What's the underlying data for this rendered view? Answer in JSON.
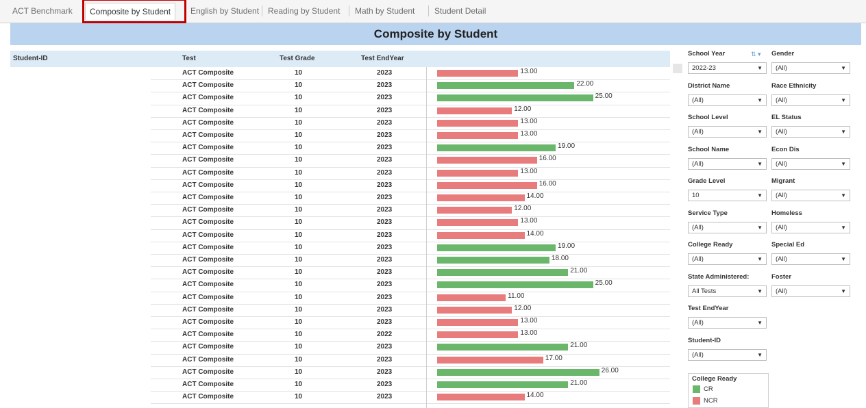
{
  "tabs": [
    "ACT Benchmark",
    "Composite by Student",
    "English by Student",
    "Reading by Student",
    "Math by Student",
    "Student Detail"
  ],
  "active_tab": "Composite by Student",
  "title": "Composite by Student",
  "columns": {
    "student_id": "Student-ID",
    "test": "Test",
    "test_grade": "Test Grade",
    "test_endyear": "Test EndYear"
  },
  "colors": {
    "cr": "#6ab76b",
    "ncr": "#e87b7b",
    "banner": "#bad4f0",
    "header": "#ddebf7"
  },
  "chart_data": {
    "type": "bar",
    "title": "Composite by Student",
    "orientation": "horizontal",
    "x_max": 28,
    "rows": [
      {
        "test": "ACT Composite",
        "grade": "10",
        "year": "2023",
        "value": 13,
        "label": "13.00",
        "status": "NCR"
      },
      {
        "test": "ACT Composite",
        "grade": "10",
        "year": "2023",
        "value": 22,
        "label": "22.00",
        "status": "CR"
      },
      {
        "test": "ACT Composite",
        "grade": "10",
        "year": "2023",
        "value": 25,
        "label": "25.00",
        "status": "CR"
      },
      {
        "test": "ACT Composite",
        "grade": "10",
        "year": "2023",
        "value": 12,
        "label": "12.00",
        "status": "NCR"
      },
      {
        "test": "ACT Composite",
        "grade": "10",
        "year": "2023",
        "value": 13,
        "label": "13.00",
        "status": "NCR"
      },
      {
        "test": "ACT Composite",
        "grade": "10",
        "year": "2023",
        "value": 13,
        "label": "13.00",
        "status": "NCR"
      },
      {
        "test": "ACT Composite",
        "grade": "10",
        "year": "2023",
        "value": 19,
        "label": "19.00",
        "status": "CR"
      },
      {
        "test": "ACT Composite",
        "grade": "10",
        "year": "2023",
        "value": 16,
        "label": "16.00",
        "status": "NCR"
      },
      {
        "test": "ACT Composite",
        "grade": "10",
        "year": "2023",
        "value": 13,
        "label": "13.00",
        "status": "NCR"
      },
      {
        "test": "ACT Composite",
        "grade": "10",
        "year": "2023",
        "value": 16,
        "label": "16.00",
        "status": "NCR"
      },
      {
        "test": "ACT Composite",
        "grade": "10",
        "year": "2023",
        "value": 14,
        "label": "14.00",
        "status": "NCR"
      },
      {
        "test": "ACT Composite",
        "grade": "10",
        "year": "2023",
        "value": 12,
        "label": "12.00",
        "status": "NCR"
      },
      {
        "test": "ACT Composite",
        "grade": "10",
        "year": "2023",
        "value": 13,
        "label": "13.00",
        "status": "NCR"
      },
      {
        "test": "ACT Composite",
        "grade": "10",
        "year": "2023",
        "value": 14,
        "label": "14.00",
        "status": "NCR"
      },
      {
        "test": "ACT Composite",
        "grade": "10",
        "year": "2023",
        "value": 19,
        "label": "19.00",
        "status": "CR"
      },
      {
        "test": "ACT Composite",
        "grade": "10",
        "year": "2023",
        "value": 18,
        "label": "18.00",
        "status": "CR"
      },
      {
        "test": "ACT Composite",
        "grade": "10",
        "year": "2023",
        "value": 21,
        "label": "21.00",
        "status": "CR"
      },
      {
        "test": "ACT Composite",
        "grade": "10",
        "year": "2023",
        "value": 25,
        "label": "25.00",
        "status": "CR"
      },
      {
        "test": "ACT Composite",
        "grade": "10",
        "year": "2023",
        "value": 11,
        "label": "11.00",
        "status": "NCR"
      },
      {
        "test": "ACT Composite",
        "grade": "10",
        "year": "2023",
        "value": 12,
        "label": "12.00",
        "status": "NCR"
      },
      {
        "test": "ACT Composite",
        "grade": "10",
        "year": "2023",
        "value": 13,
        "label": "13.00",
        "status": "NCR"
      },
      {
        "test": "ACT Composite",
        "grade": "10",
        "year": "2022",
        "value": 13,
        "label": "13.00",
        "status": "NCR"
      },
      {
        "test": "ACT Composite",
        "grade": "10",
        "year": "2023",
        "value": 21,
        "label": "21.00",
        "status": "CR"
      },
      {
        "test": "ACT Composite",
        "grade": "10",
        "year": "2023",
        "value": 17,
        "label": "17.00",
        "status": "NCR"
      },
      {
        "test": "ACT Composite",
        "grade": "10",
        "year": "2023",
        "value": 26,
        "label": "26.00",
        "status": "CR"
      },
      {
        "test": "ACT Composite",
        "grade": "10",
        "year": "2023",
        "value": 21,
        "label": "21.00",
        "status": "CR"
      },
      {
        "test": "ACT Composite",
        "grade": "10",
        "year": "2023",
        "value": 14,
        "label": "14.00",
        "status": "NCR"
      }
    ]
  },
  "filters": [
    {
      "label": "School Year",
      "value": "2022-23",
      "col": 0,
      "row": 0
    },
    {
      "label": "Gender",
      "value": "(All)",
      "col": 1,
      "row": 0
    },
    {
      "label": "District Name",
      "value": "(All)",
      "col": 0,
      "row": 1
    },
    {
      "label": "Race Ethnicity",
      "value": "(All)",
      "col": 1,
      "row": 1
    },
    {
      "label": "School Level",
      "value": "(All)",
      "col": 0,
      "row": 2
    },
    {
      "label": "EL Status",
      "value": "(All)",
      "col": 1,
      "row": 2
    },
    {
      "label": "School Name",
      "value": "(All)",
      "col": 0,
      "row": 3
    },
    {
      "label": "Econ Dis",
      "value": "(All)",
      "col": 1,
      "row": 3
    },
    {
      "label": "Grade Level",
      "value": "10",
      "col": 0,
      "row": 4
    },
    {
      "label": "Migrant",
      "value": "(All)",
      "col": 1,
      "row": 4
    },
    {
      "label": "Service Type",
      "value": "(All)",
      "col": 0,
      "row": 5
    },
    {
      "label": "Homeless",
      "value": "(All)",
      "col": 1,
      "row": 5
    },
    {
      "label": "College Ready",
      "value": "(All)",
      "col": 0,
      "row": 6
    },
    {
      "label": "Special Ed",
      "value": "(All)",
      "col": 1,
      "row": 6
    },
    {
      "label": "State Administered:",
      "value": "All Tests",
      "col": 0,
      "row": 7
    },
    {
      "label": "Foster",
      "value": "(All)",
      "col": 1,
      "row": 7
    },
    {
      "label": "Test EndYear",
      "value": "(All)",
      "col": 0,
      "row": 8
    },
    {
      "label": "Student-ID",
      "value": "(All)",
      "col": 0,
      "row": 9
    }
  ],
  "legend": {
    "title": "College Ready",
    "items": [
      {
        "label": "CR",
        "color": "#6ab76b"
      },
      {
        "label": "NCR",
        "color": "#e87b7b"
      }
    ]
  }
}
